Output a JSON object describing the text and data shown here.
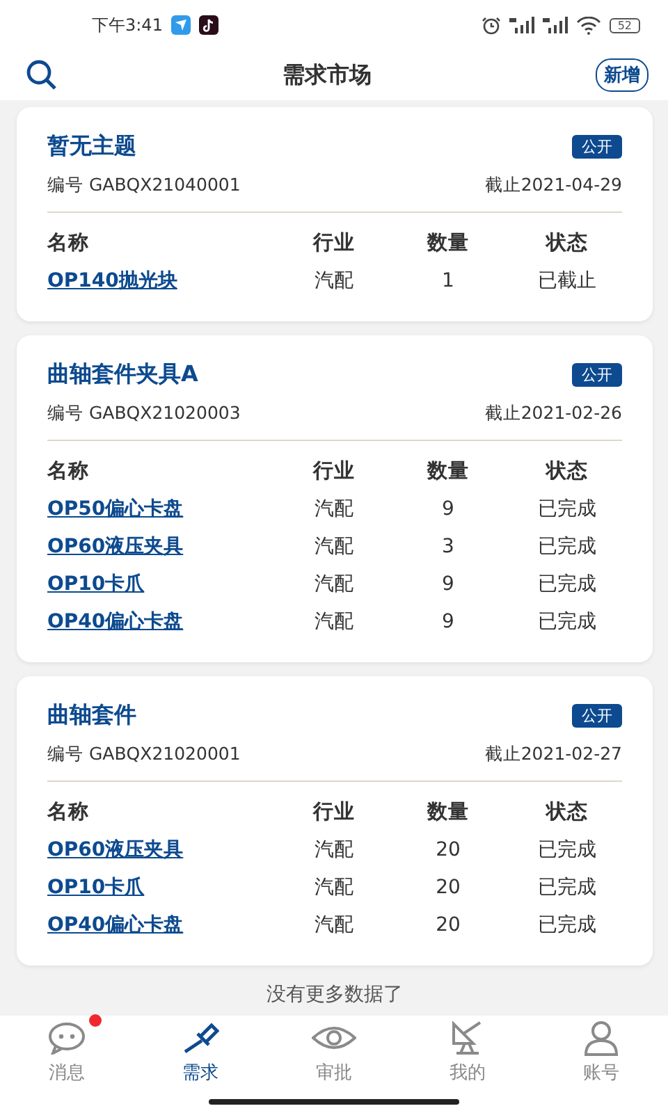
{
  "status_bar": {
    "time": "下午3:41",
    "battery": "52"
  },
  "header": {
    "title": "需求市场",
    "action": "新增"
  },
  "cards": [
    {
      "title": "暂无主题",
      "badge": "公开",
      "number": "编号 GABQX21040001",
      "deadline": "截止2021-04-29",
      "columns": [
        "名称",
        "行业",
        "数量",
        "状态"
      ],
      "rows": [
        {
          "name": "OP140抛光块",
          "industry": "汽配",
          "quantity": "1",
          "status": "已截止"
        }
      ]
    },
    {
      "title": "曲轴套件夹具A",
      "badge": "公开",
      "number": "编号 GABQX21020003",
      "deadline": "截止2021-02-26",
      "columns": [
        "名称",
        "行业",
        "数量",
        "状态"
      ],
      "rows": [
        {
          "name": "OP50偏心卡盘",
          "industry": "汽配",
          "quantity": "9",
          "status": "已完成"
        },
        {
          "name": "OP60液压夹具",
          "industry": "汽配",
          "quantity": "3",
          "status": "已完成"
        },
        {
          "name": "OP10卡爪",
          "industry": "汽配",
          "quantity": "9",
          "status": "已完成"
        },
        {
          "name": "OP40偏心卡盘",
          "industry": "汽配",
          "quantity": "9",
          "status": "已完成"
        }
      ]
    },
    {
      "title": "曲轴套件",
      "badge": "公开",
      "number": "编号 GABQX21020001",
      "deadline": "截止2021-02-27",
      "columns": [
        "名称",
        "行业",
        "数量",
        "状态"
      ],
      "rows": [
        {
          "name": "OP60液压夹具",
          "industry": "汽配",
          "quantity": "20",
          "status": "已完成"
        },
        {
          "name": "OP10卡爪",
          "industry": "汽配",
          "quantity": "20",
          "status": "已完成"
        },
        {
          "name": "OP40偏心卡盘",
          "industry": "汽配",
          "quantity": "20",
          "status": "已完成"
        }
      ]
    }
  ],
  "footer_note": "没有更多数据了",
  "tabs": [
    {
      "label": "消息",
      "selected": false,
      "unread": true
    },
    {
      "label": "需求",
      "selected": true,
      "unread": false
    },
    {
      "label": "审批",
      "selected": false,
      "unread": false
    },
    {
      "label": "我的",
      "selected": false,
      "unread": false
    },
    {
      "label": "账号",
      "selected": false,
      "unread": false
    }
  ]
}
